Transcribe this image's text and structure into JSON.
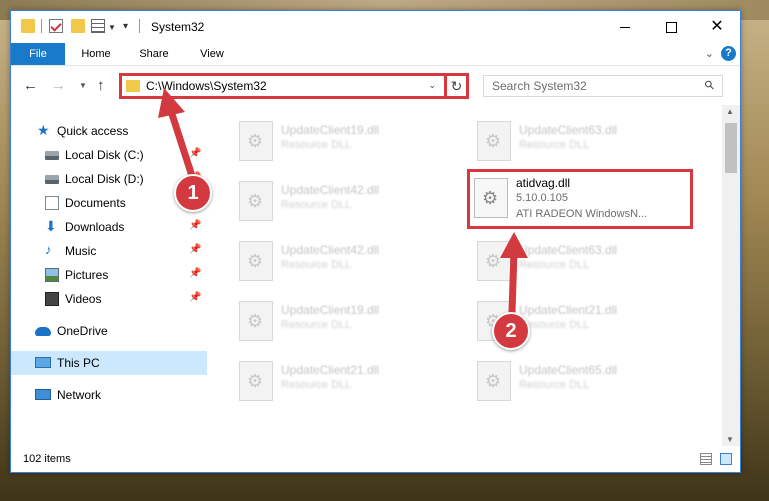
{
  "window": {
    "title": "System32"
  },
  "ribbon": {
    "tabs": [
      {
        "label": "File"
      },
      {
        "label": "Home"
      },
      {
        "label": "Share"
      },
      {
        "label": "View"
      }
    ],
    "help_label": "?"
  },
  "address": {
    "path": "C:\\Windows\\System32"
  },
  "search": {
    "placeholder": "Search System32"
  },
  "nav": {
    "items": [
      {
        "label": "Quick access",
        "icon": "star-icon"
      },
      {
        "label": "Local Disk (C:)",
        "icon": "drive-icon"
      },
      {
        "label": "Local Disk (D:)",
        "icon": "drive-icon"
      },
      {
        "label": "Documents",
        "icon": "documents-icon"
      },
      {
        "label": "Downloads",
        "icon": "downloads-icon"
      },
      {
        "label": "Music",
        "icon": "music-icon"
      },
      {
        "label": "Pictures",
        "icon": "pictures-icon"
      },
      {
        "label": "Videos",
        "icon": "videos-icon"
      },
      {
        "label": "OneDrive",
        "icon": "onedrive-icon"
      },
      {
        "label": "This PC",
        "icon": "this-pc-icon"
      },
      {
        "label": "Network",
        "icon": "network-icon"
      }
    ]
  },
  "files": [
    {
      "name": "UpdateClient19.dll",
      "type": "Resource DLL"
    },
    {
      "name": "UpdateClient63.dll",
      "type": "Resource DLL"
    },
    {
      "name": "UpdateClient42.dll",
      "type": "Resource DLL"
    },
    {
      "name": "atidvag.dll",
      "version": "5.10.0.105",
      "description": "ATI RADEON WindowsN..."
    },
    {
      "name": "UpdateClient42.dll",
      "type": "Resource DLL"
    },
    {
      "name": "UpdateClient63.dll",
      "type": "Resource DLL"
    },
    {
      "name": "UpdateClient19.dll",
      "type": "Resource DLL"
    },
    {
      "name": "UpdateClient21.dll",
      "type": "Resource DLL"
    },
    {
      "name": "UpdateClient21.dll",
      "type": "Resource DLL"
    },
    {
      "name": "UpdateClient65.dll",
      "type": "Resource DLL"
    }
  ],
  "status": {
    "item_count": "102 items"
  },
  "annotations": {
    "step1": "1",
    "step2": "2",
    "color": "#d23a3f"
  }
}
